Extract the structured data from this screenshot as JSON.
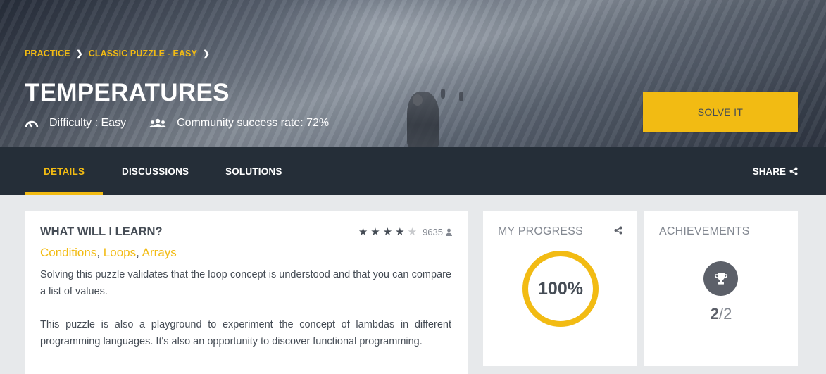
{
  "breadcrumb": [
    {
      "label": "PRACTICE"
    },
    {
      "label": "CLASSIC PUZZLE - EASY"
    }
  ],
  "puzzle": {
    "title": "TEMPERATURES",
    "difficulty_label": "Difficulty : Easy",
    "community_label": "Community success rate: 72%",
    "solve_label": "SOLVE IT"
  },
  "tabs": {
    "details": "DETAILS",
    "discussions": "DISCUSSIONS",
    "solutions": "SOLUTIONS",
    "share": "SHARE"
  },
  "learn": {
    "title": "WHAT WILL I LEARN?",
    "rating_stars": 4,
    "rating_max": 5,
    "rating_count": "9635",
    "tags": [
      "Conditions",
      "Loops",
      "Arrays"
    ],
    "tag_separator": ",",
    "description_1": "Solving this puzzle validates that the loop concept is understood and that you can compare a list of values.",
    "description_2": "This puzzle is also a playground to experiment the concept of lambdas in different programming languages. It's also an opportunity to discover functional programming."
  },
  "progress": {
    "title": "MY PROGRESS",
    "value_label": "100%",
    "value_fraction": 1.0
  },
  "achievements": {
    "title": "ACHIEVEMENTS",
    "earned": "2",
    "separator": "/",
    "total": "2"
  },
  "colors": {
    "accent": "#f2bb13",
    "dark": "#252e38",
    "text": "#454c55",
    "muted": "#838891"
  },
  "icons": {
    "difficulty": "gauge-icon",
    "community": "users-icon",
    "share": "share-icon",
    "rating_user": "user-icon",
    "achievement": "trophy-icon"
  }
}
